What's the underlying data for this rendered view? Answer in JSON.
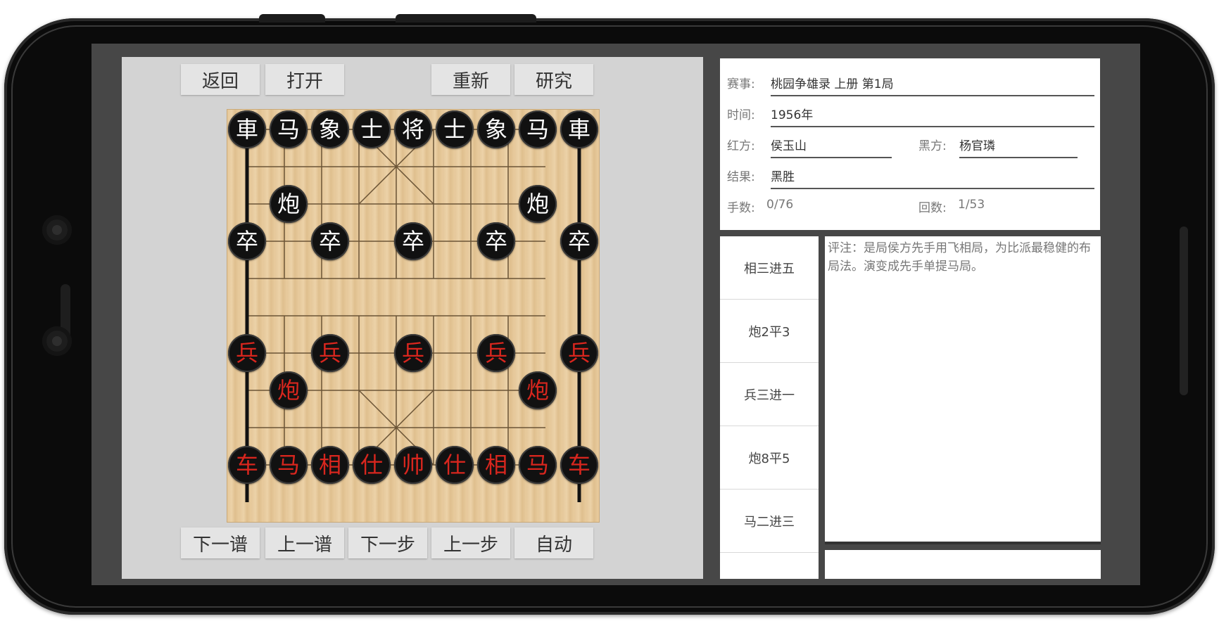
{
  "toolbar_top": {
    "back": "返回",
    "open": "打开",
    "restart": "重新",
    "study": "研究"
  },
  "toolbar_bottom": {
    "next_game": "下一谱",
    "prev_game": "上一谱",
    "next_step": "下一步",
    "prev_step": "上一步",
    "auto": "自动"
  },
  "info": {
    "event_label": "赛事:",
    "event_value": "桃园争雄录 上册 第1局",
    "time_label": "时间:",
    "time_value": "1956年",
    "red_label": "红方:",
    "red_value": "侯玉山",
    "black_label": "黑方:",
    "black_value": "杨官璘",
    "result_label": "结果:",
    "result_value": "黑胜",
    "moves_label": "手数:",
    "moves_value": "0/76",
    "rounds_label": "回数:",
    "rounds_value": "1/53"
  },
  "moves": [
    "相三进五",
    "炮2平3",
    "兵三进一",
    "炮8平5",
    "马二进三"
  ],
  "comment": "评注：是局侯方先手用飞相局，为比派最稳健的布局法。演变成先手单提马局。",
  "pieces": {
    "black_back": [
      "車",
      "马",
      "象",
      "士",
      "将",
      "士",
      "象",
      "马",
      "車"
    ],
    "black_cannon": [
      "炮",
      "炮"
    ],
    "black_pawns": [
      "卒",
      "卒",
      "卒",
      "卒",
      "卒"
    ],
    "red_pawns": [
      "兵",
      "兵",
      "兵",
      "兵",
      "兵"
    ],
    "red_cannon": [
      "炮",
      "炮"
    ],
    "red_back": [
      "车",
      "马",
      "相",
      "仕",
      "帅",
      "仕",
      "相",
      "马",
      "车"
    ]
  },
  "colors": {
    "red_piece": "#d8261e",
    "black_piece": "#ffffff",
    "board": "#e8cb9d"
  }
}
